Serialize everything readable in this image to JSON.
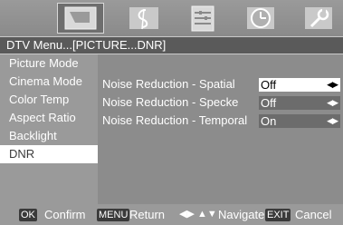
{
  "tabs": [
    {
      "name": "picture-tab-icon",
      "active": true
    },
    {
      "name": "audio-tab-icon",
      "active": false
    },
    {
      "name": "channel-tab-icon",
      "active": false
    },
    {
      "name": "time-tab-icon",
      "active": false
    },
    {
      "name": "setup-tab-icon",
      "active": false
    }
  ],
  "breadcrumb": "DTV Menu...[PICTURE...DNR]",
  "sidebar": {
    "items": [
      {
        "label": "Picture Mode"
      },
      {
        "label": "Cinema Mode"
      },
      {
        "label": "Color Temp"
      },
      {
        "label": "Aspect Ratio"
      },
      {
        "label": "Backlight"
      },
      {
        "label": "DNR"
      }
    ],
    "selected": "DNR"
  },
  "settings": [
    {
      "label": "Noise Reduction - Spatial",
      "value": "Off",
      "selected": true
    },
    {
      "label": "Noise Reduction - Specke",
      "value": "Off",
      "selected": false
    },
    {
      "label": "Noise Reduction - Temporal",
      "value": "On",
      "selected": false
    }
  ],
  "arrows": "◀▶",
  "footer": {
    "ok_key": "OK",
    "ok_text": "Confirm",
    "menu_key": "MENU",
    "menu_text": "Return",
    "nav_keys": "◀▶ ▲▼",
    "nav_text": "Navigate",
    "exit_key": "EXIT",
    "exit_text": "Cancel"
  },
  "colors": {
    "background": "#8f8f8f",
    "breadcrumb_bg": "#5a5a5a",
    "selection": "#ffffff",
    "key_bg": "#3a3a3a"
  }
}
